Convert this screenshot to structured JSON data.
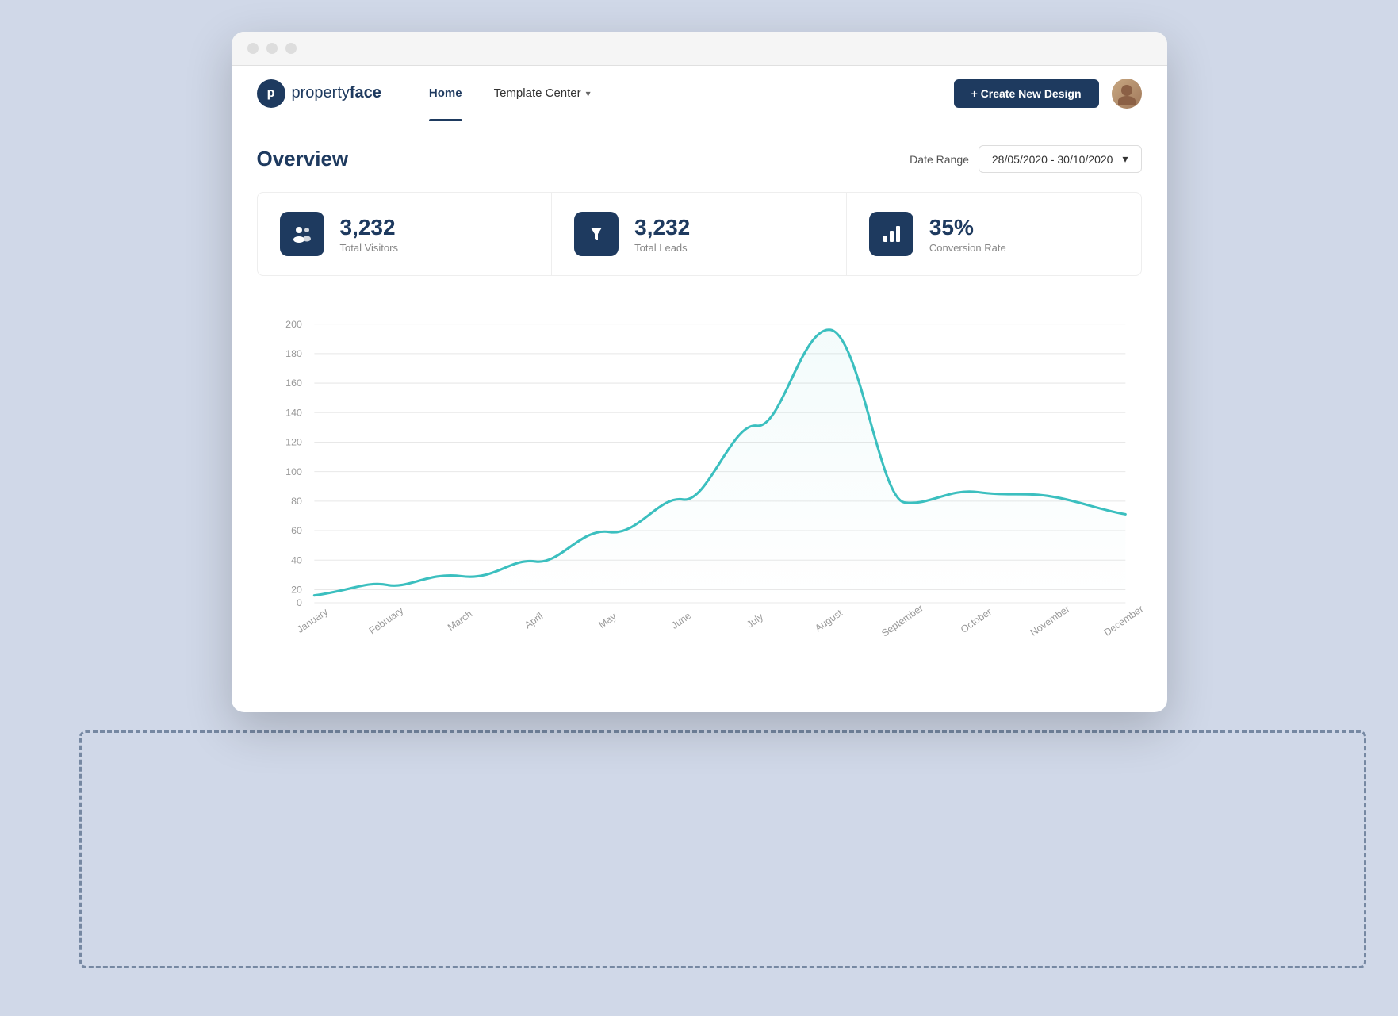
{
  "browser": {
    "dots": [
      "dot1",
      "dot2",
      "dot3"
    ]
  },
  "navbar": {
    "logo_letter": "p",
    "logo_name_light": "property",
    "logo_name_bold": "face",
    "nav_items": [
      {
        "id": "home",
        "label": "Home",
        "active": true
      },
      {
        "id": "template-center",
        "label": "Template Center",
        "has_dropdown": true
      }
    ],
    "create_button_label": "+ Create New Design",
    "date_range_label": "Date Range",
    "date_range_value": "28/05/2020 - 30/10/2020"
  },
  "overview": {
    "title": "Overview",
    "stats": [
      {
        "id": "visitors",
        "value": "3,232",
        "label": "Total Visitors",
        "icon": "people"
      },
      {
        "id": "leads",
        "value": "3,232",
        "label": "Total Leads",
        "icon": "funnel"
      },
      {
        "id": "conversion",
        "value": "35%",
        "label": "Conversion Rate",
        "icon": "bar-chart"
      }
    ]
  },
  "chart": {
    "y_labels": [
      "200",
      "180",
      "160",
      "140",
      "120",
      "100",
      "80",
      "60",
      "40",
      "20",
      "0"
    ],
    "x_labels": [
      "January",
      "February",
      "March",
      "April",
      "May",
      "June",
      "July",
      "August",
      "September",
      "October",
      "November",
      "December"
    ],
    "data_points": [
      5,
      12,
      18,
      28,
      48,
      70,
      120,
      185,
      68,
      75,
      72,
      60
    ]
  }
}
